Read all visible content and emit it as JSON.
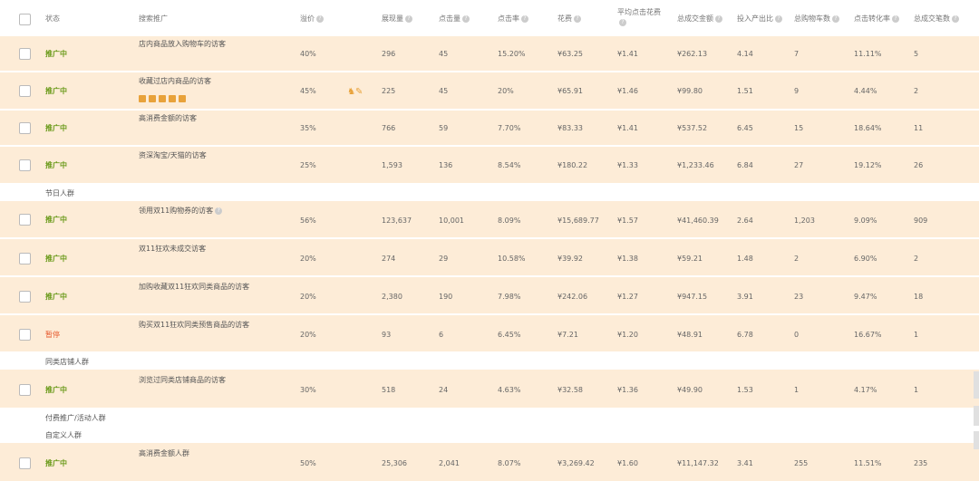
{
  "header": {
    "select_all": "",
    "columns": [
      "状态",
      "搜索推广",
      "溢价",
      "展现量",
      "点击量",
      "点击率",
      "花费",
      "平均点击花费",
      "总成交金额",
      "投入产出比",
      "总购物车数",
      "点击转化率",
      "总成交笔数"
    ]
  },
  "rows": [
    {
      "status": "推广中",
      "status_type": "on",
      "name": "店内商品放入购物车的访客",
      "premium": "40%",
      "impressions": "296",
      "clicks": "45",
      "ctr": "15.20%",
      "cost": "¥63.25",
      "cpc": "¥1.41",
      "gmv": "¥262.13",
      "roi": "4.14",
      "carts": "7",
      "cvr": "11.11%",
      "orders": "5"
    },
    {
      "status": "推广中",
      "status_type": "on",
      "name": "收藏过店内商品的访客",
      "premium": "45%",
      "impressions": "225",
      "clicks": "45",
      "ctr": "20%",
      "cost": "¥65.91",
      "cpc": "¥1.46",
      "gmv": "¥99.80",
      "roi": "1.51",
      "carts": "9",
      "cvr": "4.44%",
      "orders": "2"
    },
    {
      "status": "推广中",
      "status_type": "on",
      "name": "高消费金额的访客",
      "premium": "35%",
      "impressions": "766",
      "clicks": "59",
      "ctr": "7.70%",
      "cost": "¥83.33",
      "cpc": "¥1.41",
      "gmv": "¥537.52",
      "roi": "6.45",
      "carts": "15",
      "cvr": "18.64%",
      "orders": "11"
    },
    {
      "status": "推广中",
      "status_type": "on",
      "name": "资深淘宝/天猫的访客",
      "premium": "25%",
      "impressions": "1,593",
      "clicks": "136",
      "ctr": "8.54%",
      "cost": "¥180.22",
      "cpc": "¥1.33",
      "gmv": "¥1,233.46",
      "roi": "6.84",
      "carts": "27",
      "cvr": "19.12%",
      "orders": "26"
    },
    {
      "status": "推广中",
      "status_type": "on",
      "name": "领用双11购物券的访客",
      "premium": "56%",
      "impressions": "123,637",
      "clicks": "10,001",
      "ctr": "8.09%",
      "cost": "¥15,689.77",
      "cpc": "¥1.57",
      "gmv": "¥41,460.39",
      "roi": "2.64",
      "carts": "1,203",
      "cvr": "9.09%",
      "orders": "909"
    },
    {
      "status": "推广中",
      "status_type": "on",
      "name": "双11狂欢未成交访客",
      "premium": "20%",
      "impressions": "274",
      "clicks": "29",
      "ctr": "10.58%",
      "cost": "¥39.92",
      "cpc": "¥1.38",
      "gmv": "¥59.21",
      "roi": "1.48",
      "carts": "2",
      "cvr": "6.90%",
      "orders": "2"
    },
    {
      "status": "推广中",
      "status_type": "on",
      "name": "加购收藏双11狂欢同类商品的访客",
      "premium": "20%",
      "impressions": "2,380",
      "clicks": "190",
      "ctr": "7.98%",
      "cost": "¥242.06",
      "cpc": "¥1.27",
      "gmv": "¥947.15",
      "roi": "3.91",
      "carts": "23",
      "cvr": "9.47%",
      "orders": "18"
    },
    {
      "status": "暂停",
      "status_type": "off",
      "name": "购买双11狂欢同类预售商品的访客",
      "premium": "20%",
      "impressions": "93",
      "clicks": "6",
      "ctr": "6.45%",
      "cost": "¥7.21",
      "cpc": "¥1.20",
      "gmv": "¥48.91",
      "roi": "6.78",
      "carts": "0",
      "cvr": "16.67%",
      "orders": "1"
    },
    {
      "status": "推广中",
      "status_type": "on",
      "name": "浏览过同类店铺商品的访客",
      "premium": "30%",
      "impressions": "518",
      "clicks": "24",
      "ctr": "4.63%",
      "cost": "¥32.58",
      "cpc": "¥1.36",
      "gmv": "¥49.90",
      "roi": "1.53",
      "carts": "1",
      "cvr": "4.17%",
      "orders": "1"
    },
    {
      "status": "推广中",
      "status_type": "on",
      "name": "高消费金额人群",
      "premium": "50%",
      "impressions": "25,306",
      "clicks": "2,041",
      "ctr": "8.07%",
      "cost": "¥3,269.42",
      "cpc": "¥1.60",
      "gmv": "¥11,147.32",
      "roi": "3.41",
      "carts": "255",
      "cvr": "11.51%",
      "orders": "235"
    }
  ],
  "groups": {
    "holiday": "节日人群",
    "similar_shop": "同类店铺人群",
    "paid": "付费推广/活动人群",
    "custom": "自定义人群"
  },
  "colors": {
    "row_bg": "#fdecd7",
    "status_on": "#6a9a1a",
    "status_off": "#e65a2e",
    "accent": "#e8a23a"
  },
  "icons": [
    "pause-icon",
    "edit-icon",
    "delete-icon",
    "chart-icon",
    "copy-icon",
    "person-edit-icon",
    "question-icon"
  ]
}
